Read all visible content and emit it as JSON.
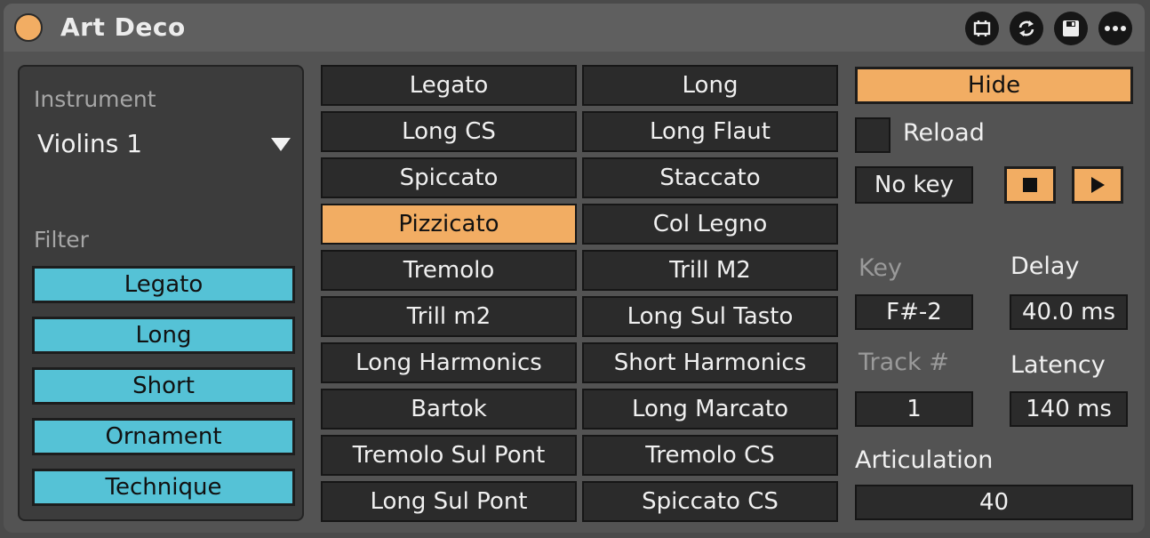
{
  "window": {
    "title": "Art Deco"
  },
  "titlebar_icons": [
    "fit-view-icon",
    "refresh-icon",
    "save-icon",
    "more-icon"
  ],
  "instrument": {
    "label": "Instrument",
    "value": "Violins 1"
  },
  "filter": {
    "label": "Filter",
    "items": [
      "Legato",
      "Long",
      "Short",
      "Ornament",
      "Technique"
    ]
  },
  "articulations": [
    [
      "Legato",
      "Long"
    ],
    [
      "Long CS",
      "Long Flaut"
    ],
    [
      "Spiccato",
      "Staccato"
    ],
    [
      "Pizzicato",
      "Col Legno"
    ],
    [
      "Tremolo",
      "Trill M2"
    ],
    [
      "Trill m2",
      "Long Sul Tasto"
    ],
    [
      "Long Harmonics",
      "Short Harmonics"
    ],
    [
      "Bartok",
      "Long Marcato"
    ],
    [
      "Tremolo Sul Pont",
      "Tremolo CS"
    ],
    [
      "Long Sul Pont",
      "Spiccato CS"
    ]
  ],
  "selected_articulation": "Pizzicato",
  "controls": {
    "hide_label": "Hide",
    "reload_label": "Reload",
    "no_key_label": "No key",
    "key_label": "Key",
    "key_value": "F#-2",
    "delay_label": "Delay",
    "delay_value": "40.0 ms",
    "track_label": "Track #",
    "track_value": "1",
    "latency_label": "Latency",
    "latency_value": "140 ms",
    "articulation_label": "Articulation",
    "articulation_value": "40"
  },
  "colors": {
    "accent": "#f2ad63",
    "filter": "#55c2d6",
    "button_bg": "#2b2b2b",
    "panel_bg": "#535353"
  }
}
